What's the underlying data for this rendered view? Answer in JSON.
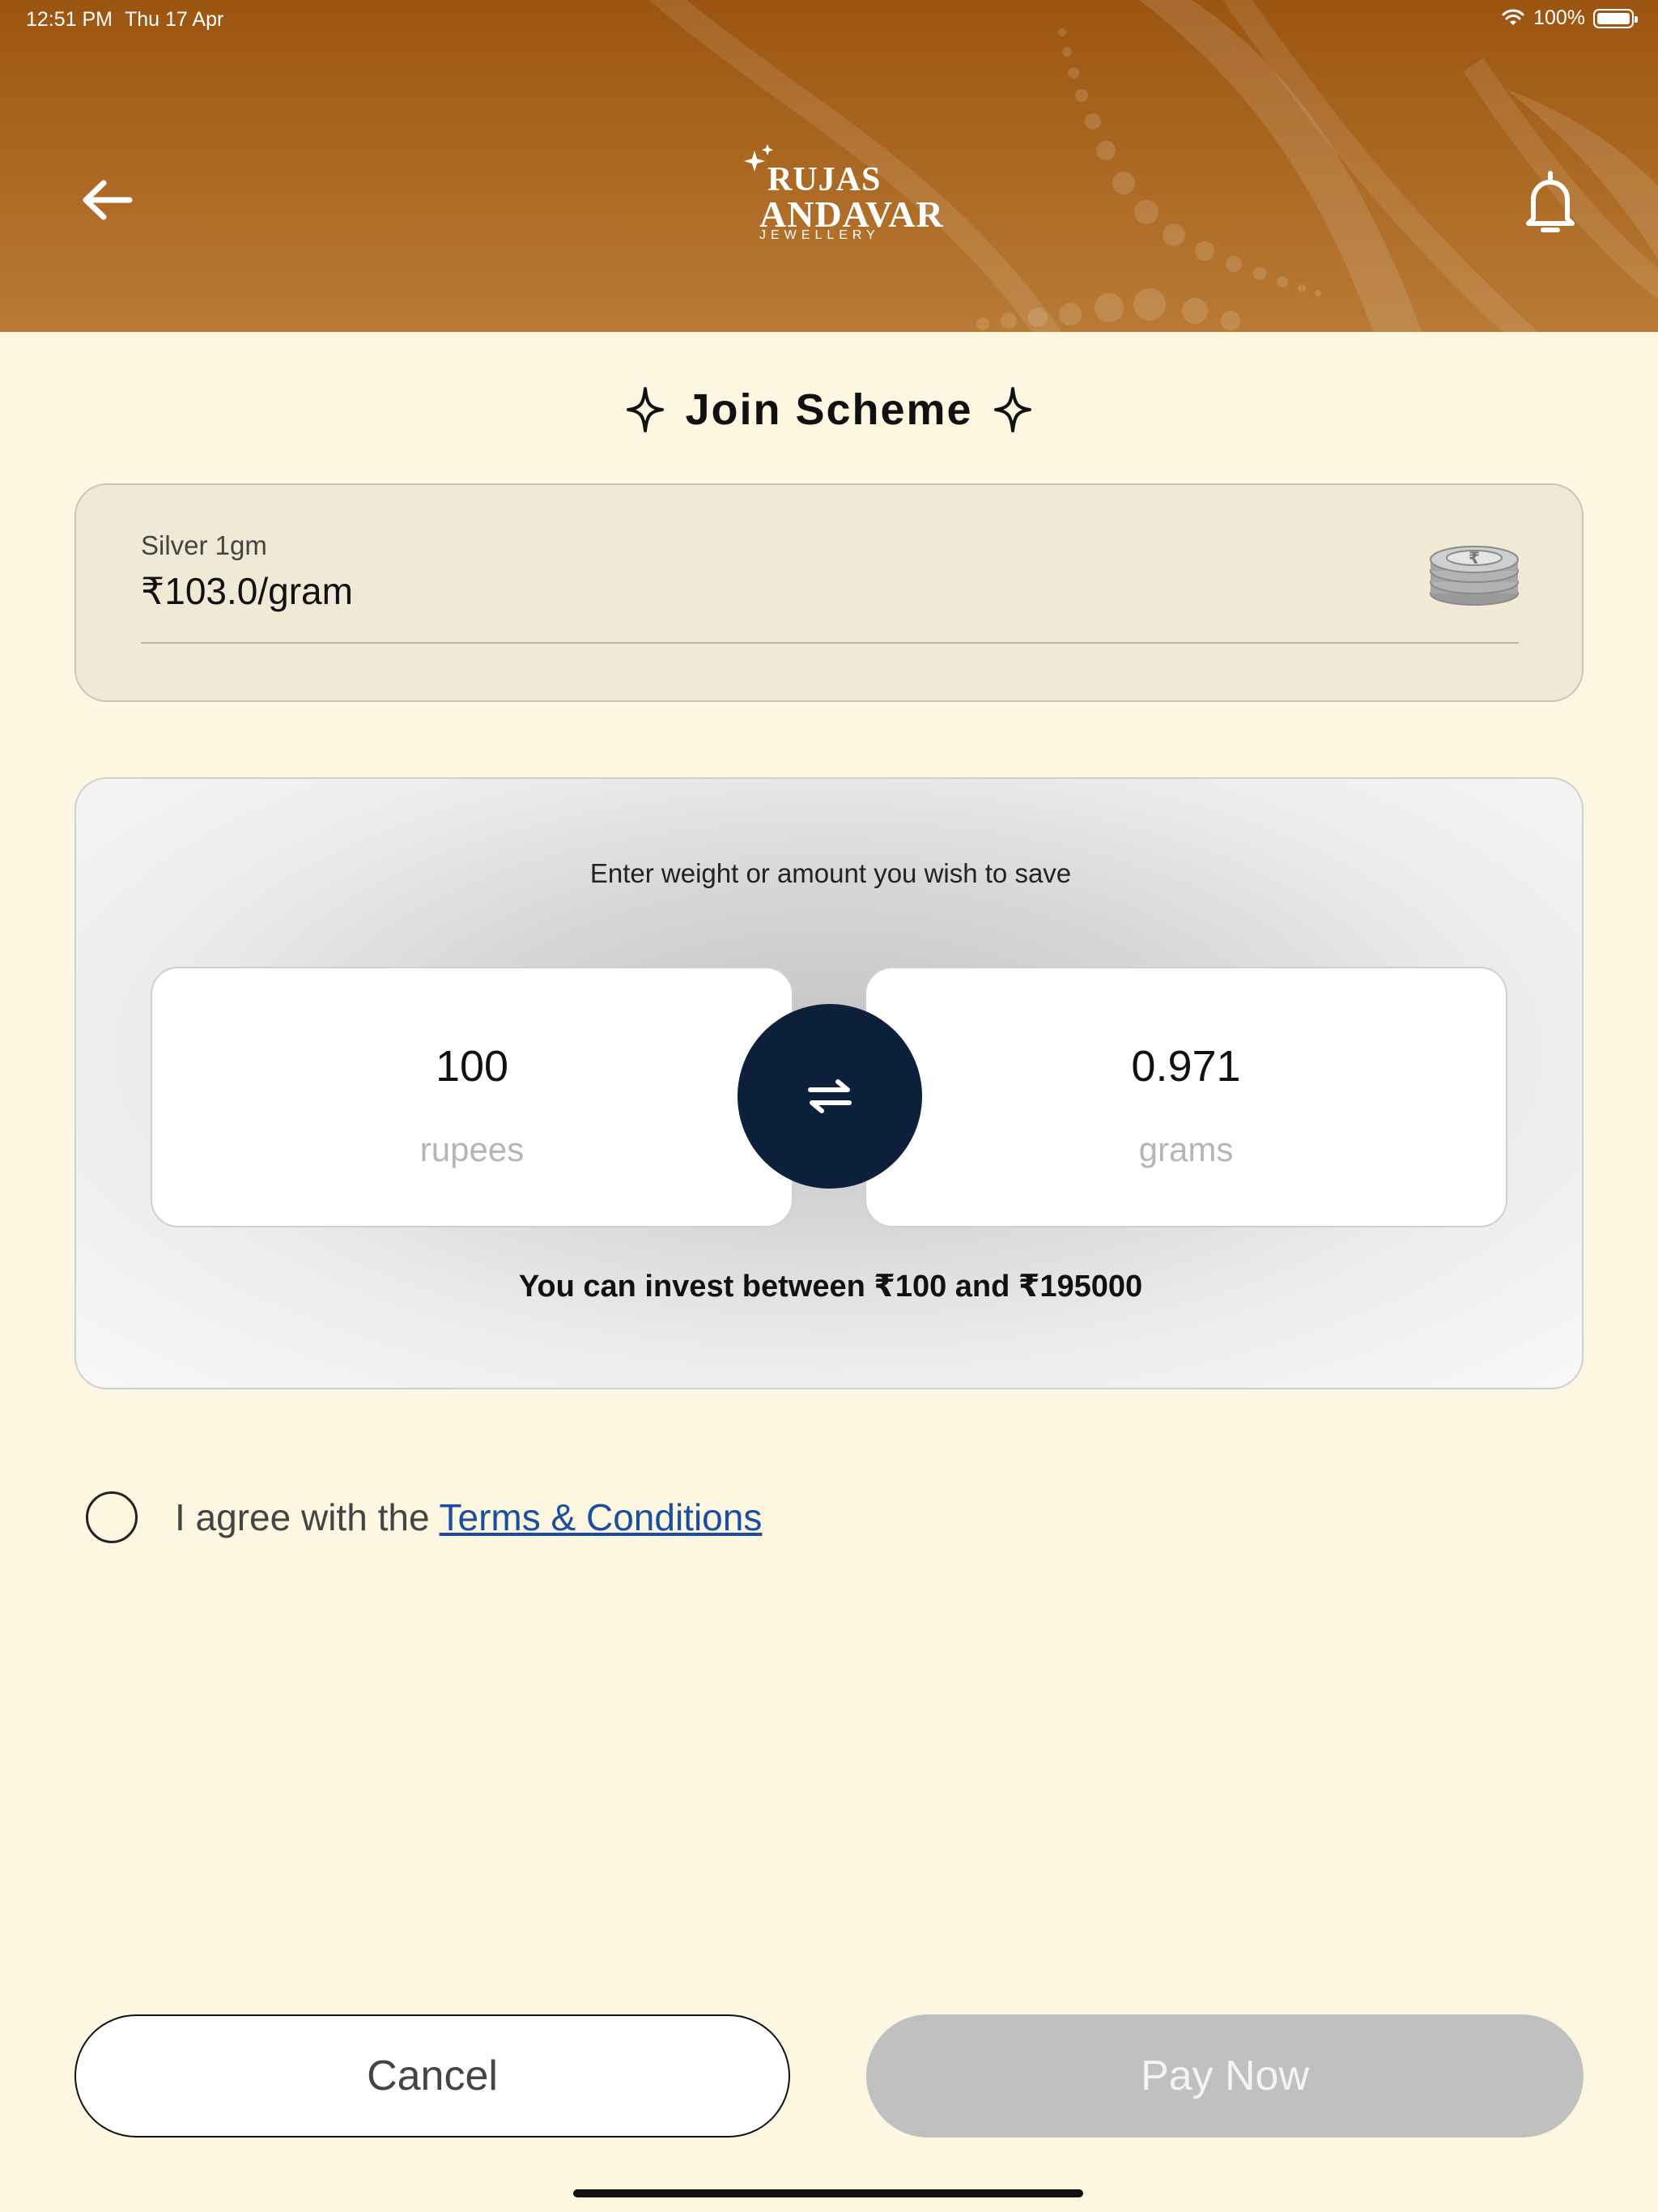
{
  "status_bar": {
    "time": "12:51 PM",
    "date": "Thu 17 Apr",
    "battery": "100%"
  },
  "header": {
    "brand_line1": "RUJAS",
    "brand_line2": "ANDAVAR",
    "brand_line3": "JEWELLERY",
    "colors": {
      "gradient_top": "#9c5511",
      "gradient_bottom": "#b87a35"
    }
  },
  "page": {
    "title": "Join Scheme"
  },
  "rate_card": {
    "label": "Silver 1gm",
    "value": "₹103.0/gram",
    "icon": "silver-coins-icon"
  },
  "amount_card": {
    "prompt": "Enter weight or amount you wish to save",
    "rupees_value": "100",
    "rupees_unit": "rupees",
    "grams_value": "0.971",
    "grams_unit": "grams",
    "range_text": "You can invest between ₹100 and ₹195000",
    "swap_color": "#0c1f3b"
  },
  "terms": {
    "text": "I agree with the",
    "link": "Terms & Conditions",
    "checked": false
  },
  "actions": {
    "cancel_label": "Cancel",
    "pay_label": "Pay Now"
  },
  "colors": {
    "page_background": "#fdf6e1",
    "link": "#1a4fa0",
    "pay_disabled": "#c0c0c0"
  }
}
